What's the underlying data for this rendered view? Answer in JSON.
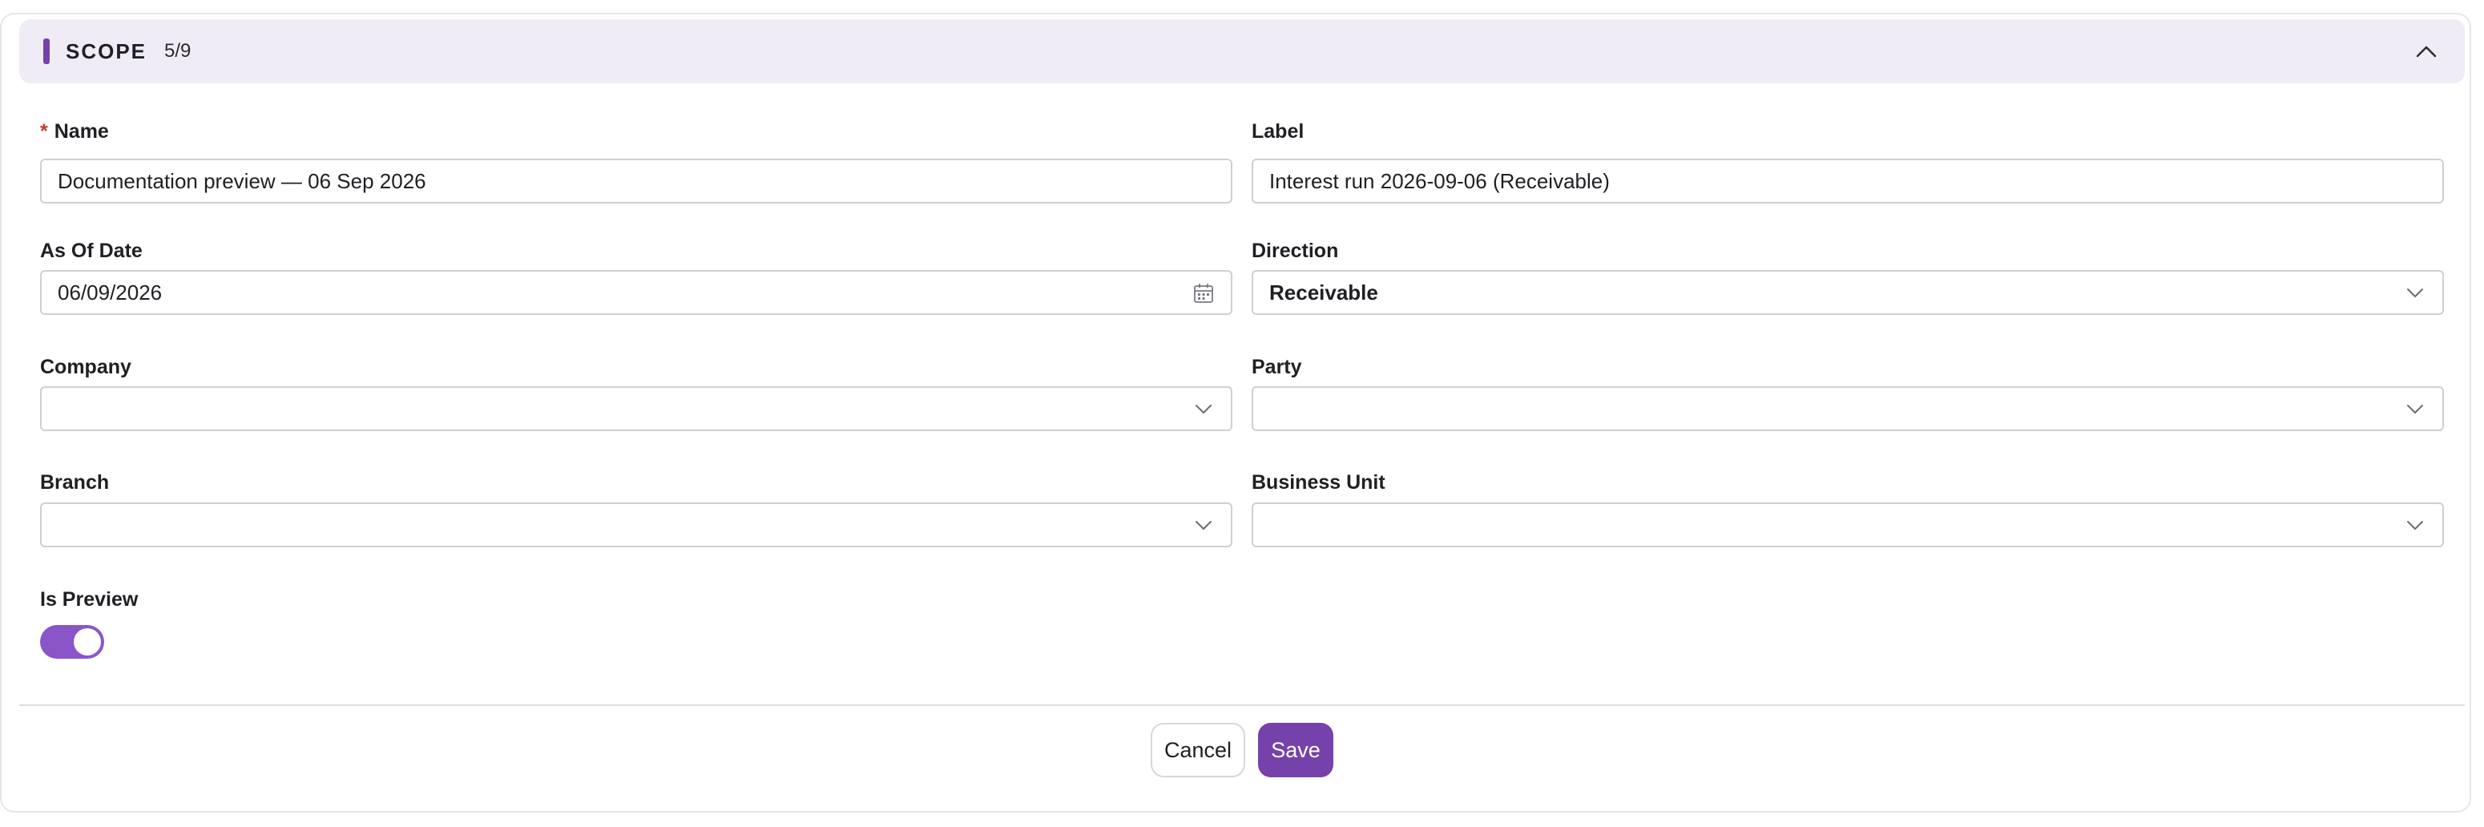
{
  "colors": {
    "accent": "#7442aa",
    "toggle_on": "#8a55c9",
    "header_bg": "#efecf6"
  },
  "section": {
    "title": "SCOPE",
    "count": "5/9",
    "collapse_icon": "chevron-up-icon"
  },
  "fields": {
    "name": {
      "label": "Name",
      "required_mark": "*",
      "value": "Documentation preview — 06 Sep 2026"
    },
    "label": {
      "label": "Label",
      "value": "Interest run 2026-09-06 (Receivable)"
    },
    "as_of_date": {
      "label": "As Of Date",
      "value": "06/09/2026",
      "icon": "calendar-icon"
    },
    "direction": {
      "label": "Direction",
      "value": "Receivable",
      "icon": "chevron-down-icon"
    },
    "company": {
      "label": "Company",
      "value": "",
      "icon": "chevron-down-icon"
    },
    "party": {
      "label": "Party",
      "value": "",
      "icon": "chevron-down-icon"
    },
    "branch": {
      "label": "Branch",
      "value": "",
      "icon": "chevron-down-icon"
    },
    "business_unit": {
      "label": "Business Unit",
      "value": "",
      "icon": "chevron-down-icon"
    },
    "is_preview": {
      "label": "Is Preview",
      "checked": true
    }
  },
  "actions": {
    "cancel_label": "Cancel",
    "save_label": "Save"
  }
}
